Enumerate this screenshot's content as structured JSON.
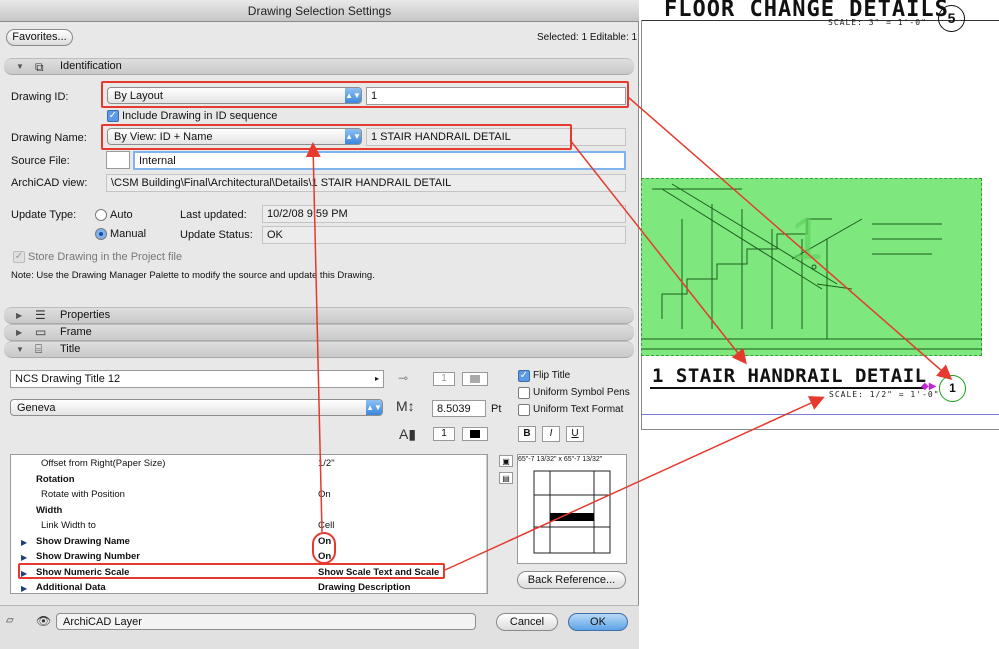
{
  "window": {
    "title": "Drawing Selection Settings"
  },
  "toolbar": {
    "favorites_label": "Favorites...",
    "selected_info": "Selected: 1 Editable: 1"
  },
  "sections": {
    "identification": "Identification",
    "properties": "Properties",
    "frame": "Frame",
    "title": "Title"
  },
  "identification": {
    "drawing_id_label": "Drawing ID:",
    "drawing_id_mode": "By Layout",
    "drawing_id_value": "1",
    "include_in_sequence_label": "Include Drawing in ID sequence",
    "include_in_sequence_checked": true,
    "drawing_name_label": "Drawing Name:",
    "drawing_name_mode": "By View: ID + Name",
    "drawing_name_value": "1 STAIR HANDRAIL DETAIL",
    "source_file_label": "Source File:",
    "source_file_value": "Internal",
    "archicad_view_label": "ArchiCAD view:",
    "archicad_view_value": "\\CSM Building\\Final\\Architectural\\Details\\1 STAIR HANDRAIL DETAIL",
    "update_type_label": "Update Type:",
    "update_auto_label": "Auto",
    "update_manual_label": "Manual",
    "update_type_selected": "Manual",
    "last_updated_label": "Last updated:",
    "last_updated_value": "10/2/08 9:59 PM",
    "update_status_label": "Update Status:",
    "update_status_value": "OK",
    "store_drawing_label": "Store Drawing in the Project file",
    "note_text": "Note:  Use the Drawing Manager Palette to modify the source and update this Drawing."
  },
  "title_panel": {
    "title_type": "NCS Drawing Title 12",
    "pen_value": "1",
    "font": "Geneva",
    "font_size": "8.5039",
    "font_unit": "Pt",
    "text_pen_value": "1",
    "flip_title_label": "Flip Title",
    "flip_title_checked": true,
    "uniform_symbol_pens_label": "Uniform Symbol Pens",
    "uniform_text_format_label": "Uniform Text Format",
    "bold_label": "B",
    "italic_label": "I",
    "underline_label": "U",
    "preview_dims": "65\"-7 13/32\" x 65\"-7 13/32\"",
    "back_reference_label": "Back Reference..."
  },
  "param_list": [
    {
      "name": "Offset from Right(Paper Size)",
      "value": "1/2\"",
      "indent": 2,
      "bold": false,
      "expandable": false
    },
    {
      "name": "Rotation",
      "value": "",
      "indent": 1,
      "bold": true,
      "expandable": false
    },
    {
      "name": "Rotate with Position",
      "value": "On",
      "indent": 2,
      "bold": false,
      "expandable": false
    },
    {
      "name": "Width",
      "value": "",
      "indent": 1,
      "bold": true,
      "expandable": false
    },
    {
      "name": "Link Width to",
      "value": "Cell",
      "indent": 2,
      "bold": false,
      "expandable": false
    },
    {
      "name": "Show Drawing Name",
      "value": "On",
      "indent": 1,
      "bold": true,
      "expandable": true
    },
    {
      "name": "Show Drawing Number",
      "value": "On",
      "indent": 1,
      "bold": true,
      "expandable": true
    },
    {
      "name": "Show Numeric Scale",
      "value": "Show Scale Text and Scale",
      "indent": 1,
      "bold": true,
      "expandable": true
    },
    {
      "name": "Additional Data",
      "value": "Drawing Description",
      "indent": 1,
      "bold": true,
      "expandable": true
    }
  ],
  "bottom": {
    "layer_label": "ArchiCAD Layer",
    "cancel_label": "Cancel",
    "ok_label": "OK"
  },
  "sheet": {
    "top_title": "FLOOR CHANGE DETAILS",
    "top_scale": "SCALE: 3\"    =    1'-0\"",
    "top_number": "5",
    "detail_title": "1 STAIR HANDRAIL DETAIL",
    "detail_scale": "SCALE: 1/2\"    =    1'-0\"",
    "detail_number": "1"
  },
  "colors": {
    "annotation": "#e53a2d",
    "drawing_fill": "#7ee87e",
    "accent": "#3b86dc"
  }
}
